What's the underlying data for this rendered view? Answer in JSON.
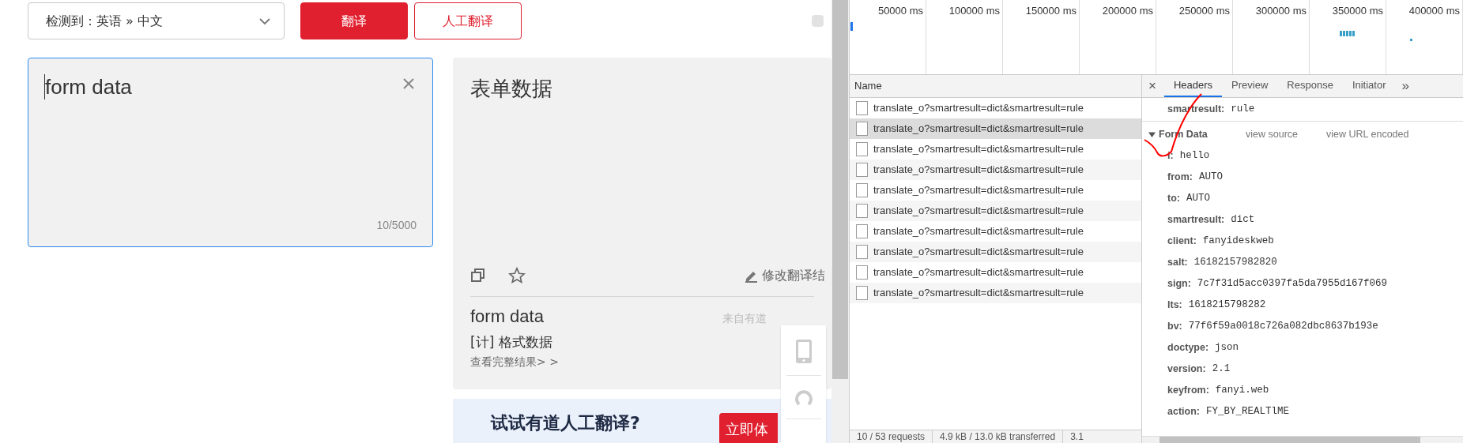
{
  "translator": {
    "language_select": "检测到：英语 » 中文",
    "buttons": [
      {
        "label": "翻译",
        "kind": "primary"
      },
      {
        "label": "人工翻译",
        "kind": "outline"
      }
    ],
    "option_checkbox": {
      "checked": false
    },
    "input": {
      "value": "form data",
      "counter": "10/5000"
    },
    "result": {
      "text": "表单数据",
      "edit_link": "修改翻译结",
      "dict_word": "form data",
      "dict_source": "来自有道",
      "definition": "[计] 格式数据",
      "more_link": "查看完整结果> >"
    },
    "promo": {
      "title": "试试有道人工翻译?",
      "button": "立即体"
    }
  },
  "devtools": {
    "timeline_ticks": [
      "50000 ms",
      "100000 ms",
      "150000 ms",
      "200000 ms",
      "250000 ms",
      "300000 ms",
      "350000 ms",
      "400000 ms"
    ],
    "name_header": "Name",
    "requests": [
      {
        "name": "translate_o?smartresult=dict&smartresult=rule",
        "selected": false
      },
      {
        "name": "translate_o?smartresult=dict&smartresult=rule",
        "selected": true
      },
      {
        "name": "translate_o?smartresult=dict&smartresult=rule",
        "selected": false
      },
      {
        "name": "translate_o?smartresult=dict&smartresult=rule",
        "selected": false
      },
      {
        "name": "translate_o?smartresult=dict&smartresult=rule",
        "selected": false
      },
      {
        "name": "translate_o?smartresult=dict&smartresult=rule",
        "selected": false
      },
      {
        "name": "translate_o?smartresult=dict&smartresult=rule",
        "selected": false
      },
      {
        "name": "translate_o?smartresult=dict&smartresult=rule",
        "selected": false
      },
      {
        "name": "translate_o?smartresult=dict&smartresult=rule",
        "selected": false
      },
      {
        "name": "translate_o?smartresult=dict&smartresult=rule",
        "selected": false
      }
    ],
    "close_tab": "×",
    "tabs": [
      {
        "label": "Headers",
        "selected": true
      },
      {
        "label": "Preview",
        "selected": false
      },
      {
        "label": "Response",
        "selected": false
      },
      {
        "label": "Initiator",
        "selected": false
      }
    ],
    "more_tabs": "»",
    "previous_field": {
      "key": "smartresult:",
      "value": "rule"
    },
    "form_data": {
      "title": "Form Data",
      "expanded": true,
      "links": [
        "view source",
        "view URL encoded"
      ],
      "fields": [
        {
          "key": "i:",
          "value": "hello"
        },
        {
          "key": "from:",
          "value": "AUTO"
        },
        {
          "key": "to:",
          "value": "AUTO"
        },
        {
          "key": "smartresult:",
          "value": "dict"
        },
        {
          "key": "client:",
          "value": "fanyideskweb"
        },
        {
          "key": "salt:",
          "value": "16182157982820"
        },
        {
          "key": "sign:",
          "value": "7c7f31d5acc0397fa5da7955d167f069"
        },
        {
          "key": "lts:",
          "value": "1618215798282"
        },
        {
          "key": "bv:",
          "value": "77f6f59a0018c726a082dbc8637b193e"
        },
        {
          "key": "doctype:",
          "value": "json"
        },
        {
          "key": "version:",
          "value": "2.1"
        },
        {
          "key": "keyfrom:",
          "value": "fanyi.web"
        },
        {
          "key": "action:",
          "value": "FY_BY_REALTlME"
        }
      ]
    },
    "status_bar": [
      "10 / 53 requests",
      "4.9 kB / 13.0 kB transferred",
      "3.1"
    ]
  }
}
